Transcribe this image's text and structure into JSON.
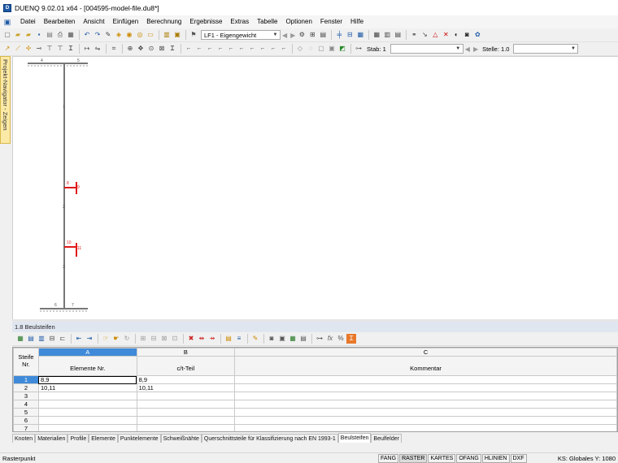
{
  "window": {
    "title": "DUENQ 9.02.01 x64 - [004595-model-file.du8*]"
  },
  "menu": [
    "Datei",
    "Bearbeiten",
    "Ansicht",
    "Einfügen",
    "Berechnung",
    "Ergebnisse",
    "Extras",
    "Tabelle",
    "Optionen",
    "Fenster",
    "Hilfe"
  ],
  "toolbar": {
    "loadcase": "LF1 - Eigengewicht",
    "stab_label": "Stab: 1",
    "stelle_label": "Stelle: 1.0"
  },
  "navigator": {
    "label": "Projekt-Navigator - Zeigen"
  },
  "model": {
    "node_labels": [
      "4",
      "5",
      "1",
      "8",
      "9",
      "2",
      "10",
      "11",
      "3",
      "6",
      "7"
    ]
  },
  "panel": {
    "title": "1.8 Beulsteifen"
  },
  "table": {
    "col_letters": [
      "A",
      "B",
      "C"
    ],
    "row_header_label": "Steife Nr.",
    "columns": [
      "Elemente Nr.",
      "c/t-Teil",
      "Kommentar"
    ],
    "rows": [
      {
        "nr": "1",
        "elemente": "8,9",
        "ct": "8,9",
        "kommentar": ""
      },
      {
        "nr": "2",
        "elemente": "10,11",
        "ct": "10,11",
        "kommentar": ""
      },
      {
        "nr": "3",
        "elemente": "",
        "ct": "",
        "kommentar": ""
      },
      {
        "nr": "4",
        "elemente": "",
        "ct": "",
        "kommentar": ""
      },
      {
        "nr": "5",
        "elemente": "",
        "ct": "",
        "kommentar": ""
      },
      {
        "nr": "6",
        "elemente": "",
        "ct": "",
        "kommentar": ""
      },
      {
        "nr": "7",
        "elemente": "",
        "ct": "",
        "kommentar": ""
      }
    ]
  },
  "tabs": [
    "Knoten",
    "Materialien",
    "Profile",
    "Elemente",
    "Punktelemente",
    "Schweißnähte",
    "Querschnittsteile für Klassifizierung nach EN 1993-1",
    "Beulsteifen",
    "Beulfelder"
  ],
  "active_tab": "Beulsteifen",
  "status": {
    "text": "Rasterpunkt",
    "buttons": [
      "FANG",
      "RASTER",
      "KARTES",
      "OFANG",
      "HLINIEN",
      "DXF"
    ],
    "coord": "KS: Globales  Y:  1080"
  }
}
